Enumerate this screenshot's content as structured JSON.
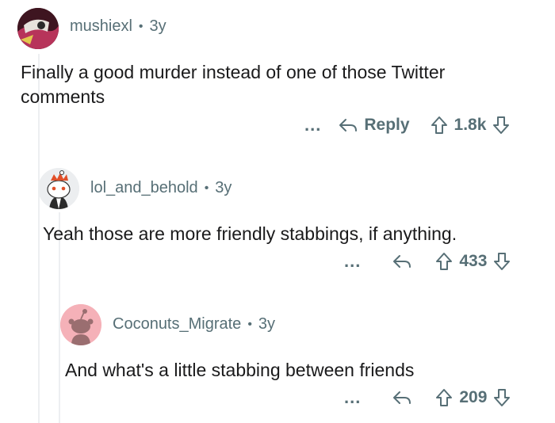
{
  "comments": [
    {
      "username": "mushiexl",
      "age": "3y",
      "text": "Finally a good murder instead of one of those Twitter comments",
      "reply_label": "Reply",
      "votes": "1.8k",
      "avatar_colors": {
        "bg": "#5a1f2b",
        "accent": "#c23a63"
      }
    },
    {
      "username": "lol_and_behold",
      "age": "3y",
      "text": "Yeah those are more friendly stabbings, if anything.",
      "votes": "433",
      "avatar_colors": {
        "bg": "#e9ecee",
        "accent": "#e0502a"
      }
    },
    {
      "username": "Coconuts_Migrate",
      "age": "3y",
      "text": "And what's a little stabbing between friends",
      "votes": "209",
      "avatar_colors": {
        "bg": "#f5b1b8",
        "accent": "#9a6e70"
      }
    }
  ],
  "meta_separator": "•",
  "more_label": "...",
  "colors": {
    "meta": "#576f76",
    "text": "#1a1a1b",
    "thread_line": "#edeff1"
  },
  "icons": [
    "more-options-icon",
    "reply-arrow-icon",
    "upvote-arrow-icon",
    "downvote-arrow-icon"
  ]
}
